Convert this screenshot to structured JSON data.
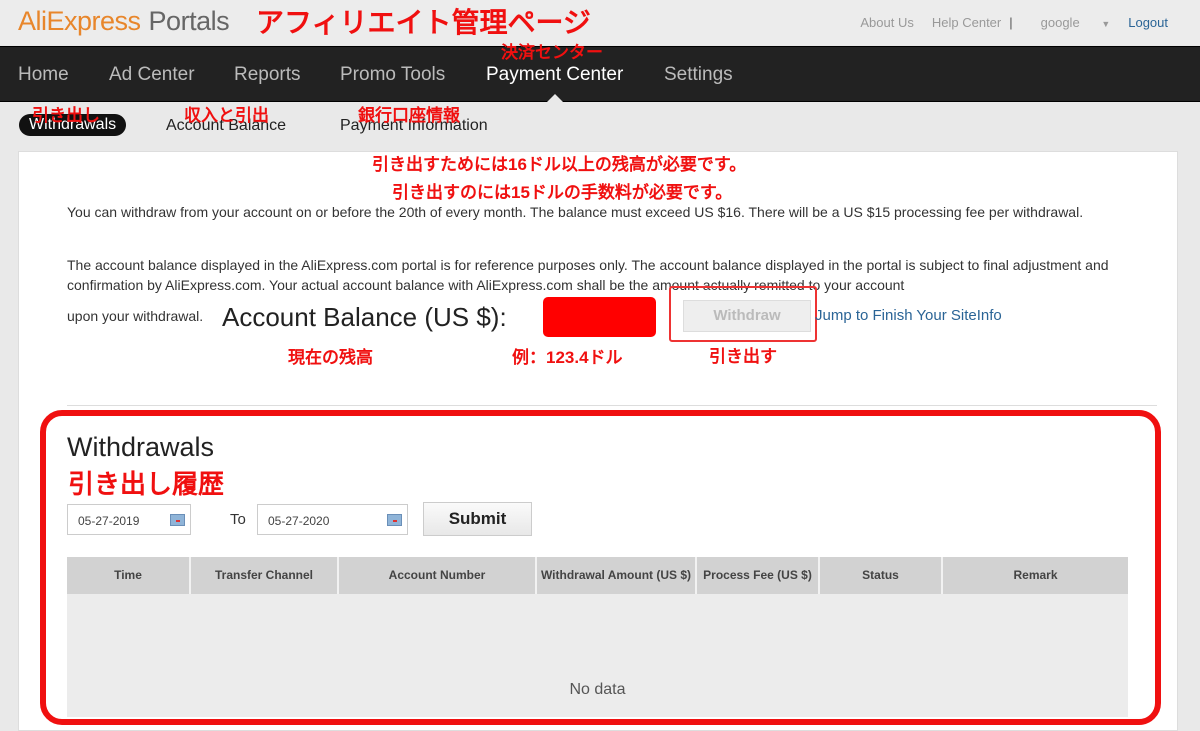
{
  "header": {
    "logo_brand": "AliExpress",
    "logo_product": "Portals",
    "links": [
      "About Us",
      "Help Center"
    ],
    "user": "google",
    "logout": "Logout"
  },
  "nav": {
    "items": [
      "Home",
      "Ad Center",
      "Reports",
      "Promo Tools",
      "Payment Center",
      "Settings"
    ],
    "active": "Payment Center"
  },
  "subtabs": [
    "Withdrawals",
    "Account Balance",
    "Payment Information"
  ],
  "info": {
    "p1": "You can withdraw from your account on or before the 20th of every month. The balance must exceed US $16. There will be a US $15 processing fee per withdrawal.",
    "p2": "The account balance displayed in the AliExpress.com portal is for reference purposes only. The account balance displayed in the portal is subject to final adjustment and confirmation by AliExpress.com. Your actual account balance with AliExpress.com shall be the amount actually remitted to your account",
    "p3": "upon your withdrawal.",
    "balance_label": "Account Balance (US $):",
    "withdraw_button": "Withdraw",
    "jump_link": "Jump to Finish Your SiteInfo"
  },
  "withdrawals": {
    "title": "Withdrawals",
    "from_date": "05-27-2019",
    "to_label": "To",
    "to_date": "05-27-2020",
    "submit": "Submit",
    "columns": [
      "Time",
      "Transfer Channel",
      "Account Number",
      "Withdrawal Amount (US $)",
      "Process Fee (US $)",
      "Status",
      "Remark"
    ],
    "empty": "No data"
  },
  "annotations": {
    "title": "アフィリエイト管理ページ",
    "payment_center": "決済センター",
    "withdrawals_tab": "引き出し",
    "balance_tab": "収入と引出",
    "payment_info_tab": "銀行口座情報",
    "note1": "引き出すためには16ドル以上の残高が必要です。",
    "note2": "引き出すのには15ドルの手数料が必要です。",
    "current_balance": "現在の残高",
    "example": "例：123.4ドル",
    "withdraw": "引き出す",
    "history": "引き出し履歴"
  },
  "colors": {
    "annotation": "#f01010",
    "nav_bg": "#222222",
    "link": "#2a6496",
    "logo_orange": "#e8862b"
  }
}
